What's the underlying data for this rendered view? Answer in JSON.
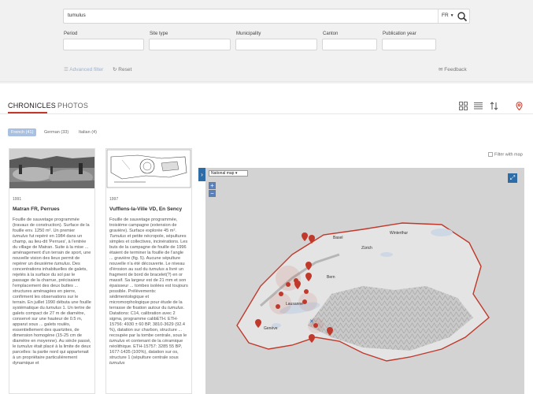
{
  "search": {
    "value": "tumulus",
    "lang": "FR"
  },
  "filters": {
    "period": "Period",
    "site_type": "Site type",
    "municipality": "Municipality",
    "canton": "Canton",
    "publication_year": "Publication year",
    "advanced_filter": "Advanced filter",
    "reset": "Reset",
    "feedback": "Feedback"
  },
  "tabs": {
    "chronicles": "CHRONICLES",
    "photos": "PHOTOS"
  },
  "languages": {
    "french": "French (41)",
    "german": "German (33)",
    "italian": "Italian (4)"
  },
  "cards": [
    {
      "year": "1991",
      "title": "Matran FR, Perrues",
      "body": [
        {
          "t": "Fouille de sauvetage programmée (travaux de construction). Surface de la fouille env. 1250 m². Un premier "
        },
        {
          "t": "tumulus",
          "i": true
        },
        {
          "t": " fut repéré en 1984 dans un champ, au lieu-dit 'Perrues', à l'entrée du village de Matran. Suite à la mise ... aménagement d'un terrain de sport, une nouvelle vision des lieux permit de repérer un deuxième "
        },
        {
          "t": "tumulus",
          "i": true
        },
        {
          "t": ". Des concentrations inhabituelles de galets, rejetés à la surface du sol par le passage de la charrue, précisaient l'emplacement des deux buttes ... structures aménagées en pierre, confirment les observations sur le terrain. En juillet 1990 débuta une fouille systématique du "
        },
        {
          "t": "tumulus",
          "i": true
        },
        {
          "t": " 1. Un tertre de galets compact de 27 m de diamètre, conservé sur une hauteur de 0.5 m, apparut sous ... galets roulés, essentiellement des quartzites, de dimension homogène (15-25 cm de diamètre en moyenne). Au siècle passé, le "
        },
        {
          "t": "tumulus",
          "i": true
        },
        {
          "t": " était placé à la limite de deux parcelles: la partie nord qui appartenait à un propriétaire particulièrement dynamique et"
        }
      ]
    },
    {
      "year": "1997",
      "title": "Vufflens-la-Ville VD, En Sency",
      "body": [
        {
          "t": "Fouille de sauvetage programmée, troisième campagne (extension de gravière). Surface explorée 45 m². "
        },
        {
          "t": "Tumulus",
          "i": true
        },
        {
          "t": " et petite nécropole, sépultures simples et collectives, incinérations. Les buts de la campagne de fouille de 1996 étaient de terminer la fouille de l'angle ... gravière (fig. 5). Aucune sépulture nouvelle n'a été découverte. Le niveau d'érosion au sud du "
        },
        {
          "t": "tumulus",
          "i": true
        },
        {
          "t": " a livré un fragment de bord de bracelet(?) en or massif. Sa largeur est de 21 mm et son épaisseur ... tombes isolées est toujours possible. Prélèvements: sédimentologique et micromorphologique pour étude de la terrasse de fixation autour du "
        },
        {
          "t": "tumulus",
          "i": true
        },
        {
          "t": ". Datations: C14, calibration avec 2 sigma, programme calibETH. ETH-15756: 4930 ± 60 BP, 3810-3629 (92.4 %), datation sur charbon, structure ... recoupée par la tombe centrale, sous le "
        },
        {
          "t": "tumulus",
          "i": true
        },
        {
          "t": " et contenant de la céramique néolithique. ETH-15757: 3285 55 BP, 1677-1435 (100%), datation sur os, structure 1 (sépulture centrale sous "
        },
        {
          "t": "tumulus",
          "i": true
        }
      ]
    }
  ],
  "map": {
    "filter_with_map": "Filter with map",
    "layer_select": "National map",
    "cities": [
      "Basel",
      "Winterthur",
      "Zürich",
      "Bern",
      "Lausanne",
      "Genève"
    ]
  },
  "colors": {
    "accent": "#c0392b",
    "link_blue": "#2d6ca6",
    "pill": "#a9c0e0"
  }
}
